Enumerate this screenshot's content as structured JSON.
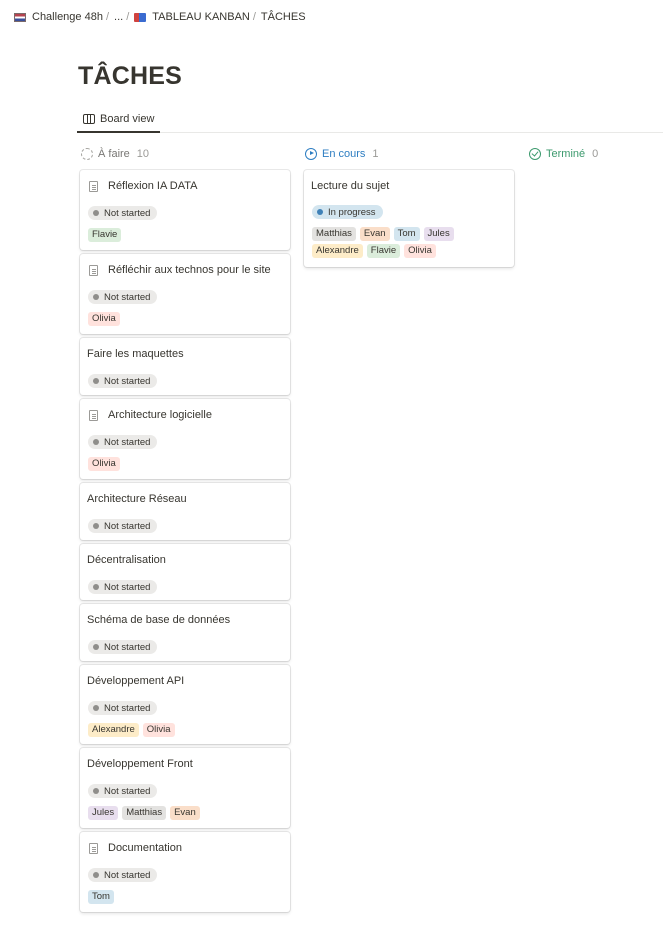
{
  "breadcrumb": {
    "items": [
      {
        "label": "Challenge 48h",
        "icon": "flag-icon"
      },
      {
        "label": "..."
      },
      {
        "label": "TABLEAU KANBAN",
        "icon": "board-icon"
      },
      {
        "label": "TÂCHES"
      }
    ],
    "separator": "/"
  },
  "page": {
    "title": "TÂCHES"
  },
  "views": [
    {
      "label": "Board view",
      "icon": "board-view-icon",
      "active": true
    }
  ],
  "colors": {
    "todo_header": "#787774",
    "in_progress_header": "#2e7ec2",
    "done_header": "#3d9a6e"
  },
  "columns": [
    {
      "label": "À faire",
      "count": "10",
      "cards": [
        {
          "title": "Réflexion IA DATA",
          "has_doc_icon": true,
          "status": "Not started",
          "people": [
            {
              "name": "Flavie",
              "color": "green"
            }
          ]
        },
        {
          "title": "Réfléchir aux technos pour le site",
          "has_doc_icon": true,
          "status": "Not started",
          "people": [
            {
              "name": "Olivia",
              "color": "red"
            }
          ]
        },
        {
          "title": "Faire les maquettes",
          "has_doc_icon": false,
          "status": "Not started",
          "people": []
        },
        {
          "title": "Architecture logicielle",
          "has_doc_icon": true,
          "status": "Not started",
          "people": [
            {
              "name": "Olivia",
              "color": "red"
            }
          ]
        },
        {
          "title": "Architecture Réseau",
          "has_doc_icon": false,
          "status": "Not started",
          "people": []
        },
        {
          "title": "Décentralisation",
          "has_doc_icon": false,
          "status": "Not started",
          "people": []
        },
        {
          "title": "Schéma de base de données",
          "has_doc_icon": false,
          "status": "Not started",
          "people": []
        },
        {
          "title": "Développement API",
          "has_doc_icon": false,
          "status": "Not started",
          "people": [
            {
              "name": "Alexandre",
              "color": "yellow"
            },
            {
              "name": "Olivia",
              "color": "red"
            }
          ]
        },
        {
          "title": "Développement Front",
          "has_doc_icon": false,
          "status": "Not started",
          "people": [
            {
              "name": "Jules",
              "color": "purple"
            },
            {
              "name": "Matthias",
              "color": "gray"
            },
            {
              "name": "Evan",
              "color": "orange"
            }
          ]
        },
        {
          "title": "Documentation",
          "has_doc_icon": true,
          "status": "Not started",
          "people": [
            {
              "name": "Tom",
              "color": "blue"
            }
          ]
        }
      ]
    },
    {
      "label": "En cours",
      "count": "1",
      "cards": [
        {
          "title": "Lecture du sujet",
          "has_doc_icon": false,
          "status": "In progress",
          "people": [
            {
              "name": "Matthias",
              "color": "gray"
            },
            {
              "name": "Evan",
              "color": "orange"
            },
            {
              "name": "Tom",
              "color": "blue"
            },
            {
              "name": "Jules",
              "color": "purple"
            },
            {
              "name": "Alexandre",
              "color": "yellow"
            },
            {
              "name": "Flavie",
              "color": "green"
            },
            {
              "name": "Olivia",
              "color": "red"
            }
          ]
        }
      ]
    },
    {
      "label": "Terminé",
      "count": "0",
      "cards": []
    }
  ]
}
